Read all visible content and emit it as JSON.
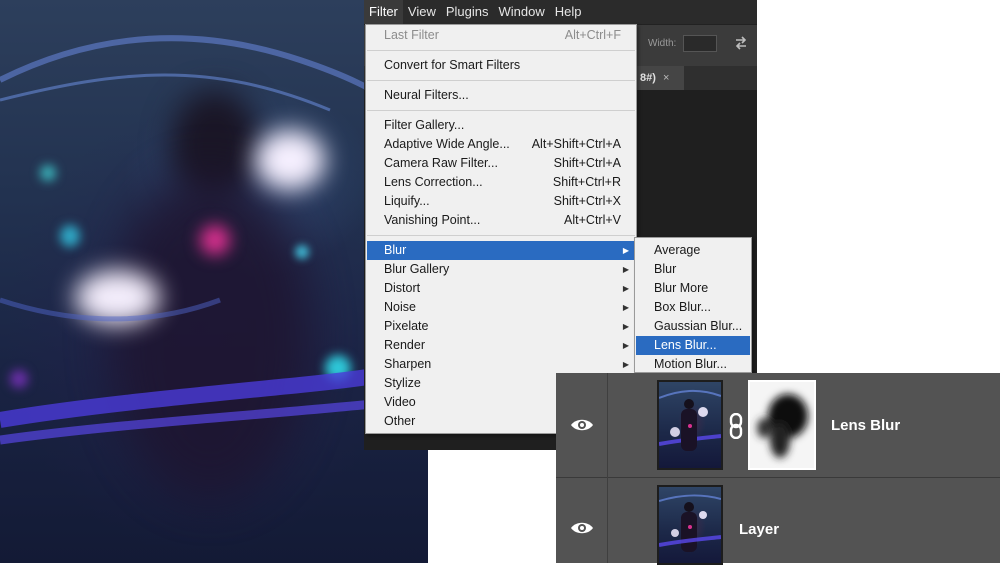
{
  "menubar": {
    "items": [
      "Filter",
      "View",
      "Plugins",
      "Window",
      "Help"
    ],
    "active": "Filter"
  },
  "options_bar": {
    "width_label": "Width:"
  },
  "document_tab": {
    "label": "8#)",
    "close": "×"
  },
  "filter_menu": {
    "last_filter": {
      "label": "Last Filter",
      "shortcut": "Alt+Ctrl+F"
    },
    "convert_smart": {
      "label": "Convert for Smart Filters"
    },
    "neural": {
      "label": "Neural Filters..."
    },
    "gallery": {
      "label": "Filter Gallery..."
    },
    "adaptive": {
      "label": "Adaptive Wide Angle...",
      "shortcut": "Alt+Shift+Ctrl+A"
    },
    "camera_raw": {
      "label": "Camera Raw Filter...",
      "shortcut": "Shift+Ctrl+A"
    },
    "lens_correction": {
      "label": "Lens Correction...",
      "shortcut": "Shift+Ctrl+R"
    },
    "liquify": {
      "label": "Liquify...",
      "shortcut": "Shift+Ctrl+X"
    },
    "vanishing": {
      "label": "Vanishing Point...",
      "shortcut": "Alt+Ctrl+V"
    },
    "submenus": [
      "Blur",
      "Blur Gallery",
      "Distort",
      "Noise",
      "Pixelate",
      "Render",
      "Sharpen",
      "Stylize",
      "Video",
      "Other"
    ]
  },
  "blur_submenu": {
    "items": [
      "Average",
      "Blur",
      "Blur More",
      "Box Blur...",
      "Gaussian Blur...",
      "Lens Blur...",
      "Motion Blur..."
    ],
    "highlighted": "Lens Blur..."
  },
  "layers": [
    {
      "name": "Lens Blur",
      "visible": true,
      "has_mask": true
    },
    {
      "name": "Layer",
      "visible": true,
      "has_mask": false
    }
  ],
  "colors": {
    "menu_highlight": "#2a6bc1",
    "menu_bg": "#f0f0f0",
    "panel_bg": "#535353"
  }
}
